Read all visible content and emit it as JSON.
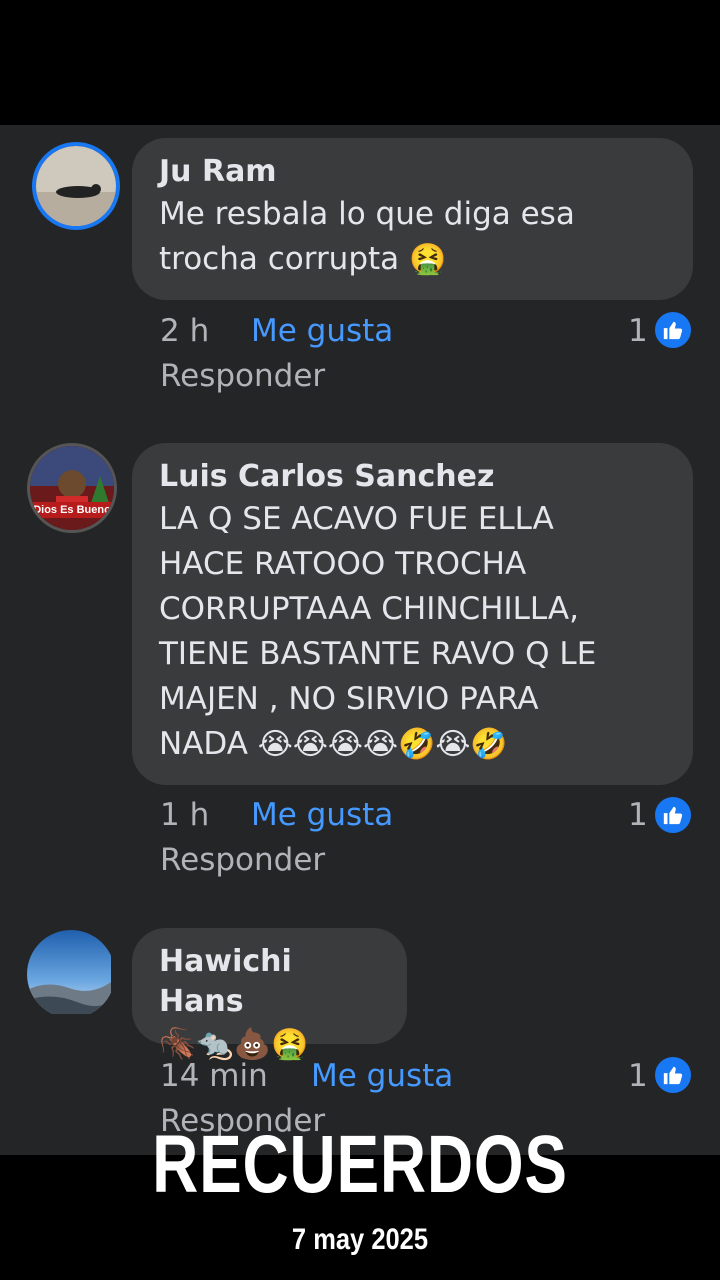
{
  "comments": [
    {
      "author": "Ju Ram",
      "lines": [
        "Me resbala lo que diga esa",
        "trocha corrupta"
      ],
      "emoji": "🤮",
      "time": "2 h",
      "like_label": "Me gusta",
      "reply_label": "Responder",
      "like_count": "1"
    },
    {
      "author": "Luis Carlos Sanchez",
      "avatar_text": "Dios Es Bueno",
      "lines": [
        "LA Q SE ACAVO FUE ELLA",
        "HACE RATOOO TROCHA",
        "CORRUPTAAA CHINCHILLA,",
        "TIENE BASTANTE RAVO Q LE",
        "MAJEN , NO SIRVIO PARA",
        "NADA"
      ],
      "emoji": "😭😭😭😭🤣😭🤣",
      "time": "1 h",
      "like_label": "Me gusta",
      "reply_label": "Responder",
      "like_count": "1"
    },
    {
      "author": "Hawichi Hans",
      "emoji": "🪳🐀💩🤮",
      "time": "14 min",
      "like_label": "Me gusta",
      "reply_label": "Responder",
      "like_count": "1"
    }
  ],
  "overlay": {
    "title": "RECUERDOS",
    "date": "7 may 2025"
  },
  "colors": {
    "background": "#242526",
    "bubble": "#3a3b3c",
    "link_blue": "#4599ff",
    "like_badge": "#1877f2",
    "text": "#e4e6eb",
    "muted": "#b0b3b8"
  }
}
